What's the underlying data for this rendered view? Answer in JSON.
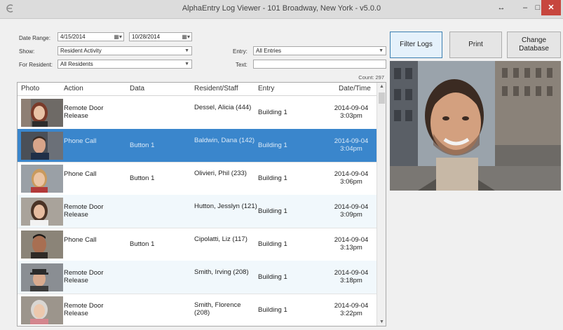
{
  "window": {
    "title": "AlphaEntry Log Viewer - 101 Broadway, New York - v5.0.0",
    "resize_glyph": "↔",
    "minimize_glyph": "–",
    "maximize_glyph": "□",
    "close_glyph": "✕"
  },
  "filters": {
    "date_range_label": "Date Range:",
    "date_from": "4/15/2014",
    "date_to": "10/28/2014",
    "show_label": "Show:",
    "show_value": "Resident Activity",
    "for_resident_label": "For Resident:",
    "for_resident_value": "All Residents",
    "entry_label": "Entry:",
    "entry_value": "All Entries",
    "text_label": "Text:",
    "text_value": ""
  },
  "buttons": {
    "filter_logs": "Filter Logs",
    "print": "Print",
    "change_database": "Change Database"
  },
  "count_text": "Count: 297",
  "table": {
    "headers": [
      "Photo",
      "Action",
      "Data",
      "Resident/Staff",
      "Entry",
      "Date/Time"
    ],
    "rows": [
      {
        "action": "Remote Door Release",
        "data": "",
        "resident": "Dessel, Alicia (444)",
        "entry": "Building 1",
        "date": "2014-09-04",
        "time": "3:03pm"
      },
      {
        "action": "Phone Call",
        "data": "Button 1",
        "resident": "Baldwin, Dana (142)",
        "entry": "Building 1",
        "date": "2014-09-04",
        "time": "3:04pm"
      },
      {
        "action": "Phone Call",
        "data": "Button 1",
        "resident": "Olivieri, Phil (233)",
        "entry": "Building 1",
        "date": "2014-09-04",
        "time": "3:06pm"
      },
      {
        "action": "Remote Door Release",
        "data": "",
        "resident": "Hutton, Jesslyn (121)",
        "entry": "Building 1",
        "date": "2014-09-04",
        "time": "3:09pm"
      },
      {
        "action": "Phone Call",
        "data": "Button 1",
        "resident": "Cipolatti, Liz (117)",
        "entry": "Building 1",
        "date": "2014-09-04",
        "time": "3:13pm"
      },
      {
        "action": "Remote Door Release",
        "data": "",
        "resident": "Smith, Irving (208)",
        "entry": "Building 1",
        "date": "2014-09-04",
        "time": "3:18pm"
      },
      {
        "action": "Remote Door Release",
        "data": "",
        "resident": "Smith, Florence (208)",
        "entry": "Building 1",
        "date": "2014-09-04",
        "time": "3:22pm"
      }
    ],
    "selected_row": 1
  },
  "colors": {
    "selection": "#3a86cc",
    "close_button": "#c7463e"
  }
}
